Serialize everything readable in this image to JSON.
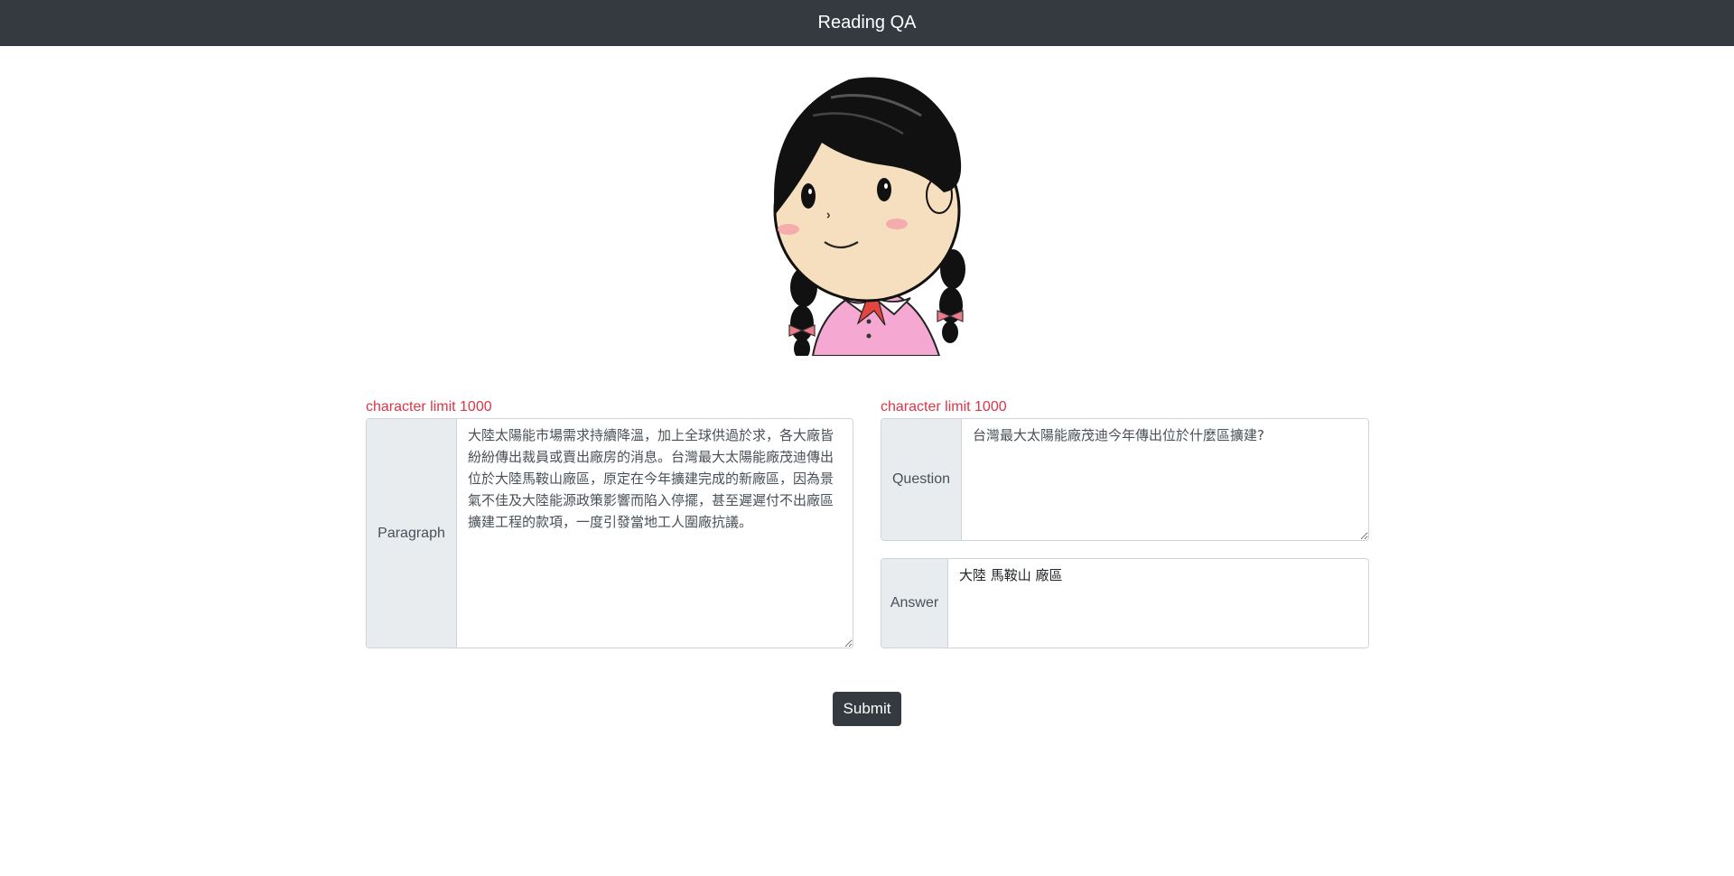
{
  "navbar": {
    "title": "Reading QA"
  },
  "paragraph": {
    "limit_note": "character limit 1000",
    "label": "Paragraph",
    "value": "大陸太陽能市場需求持續降溫，加上全球供過於求，各大廠皆紛紛傳出裁員或賣出廠房的消息。台灣最大太陽能廠茂迪傳出位於大陸馬鞍山廠區，原定在今年擴建完成的新廠區，因為景氣不佳及大陸能源政策影響而陷入停擺，甚至遲遲付不出廠區擴建工程的款項，一度引發當地工人圍廠抗議。"
  },
  "question": {
    "limit_note": "character limit 1000",
    "label": "Question",
    "value": "台灣最大太陽能廠茂迪今年傳出位於什麼區擴建?"
  },
  "answer": {
    "label": "Answer",
    "value": "大陸 馬鞍山 廠區"
  },
  "submit_label": "Submit",
  "avatar": {
    "icon": "girl-avatar-icon"
  },
  "colors": {
    "navbar": "#343a40",
    "limit_text": "#dc3545",
    "label_bg": "#e9ecef"
  }
}
